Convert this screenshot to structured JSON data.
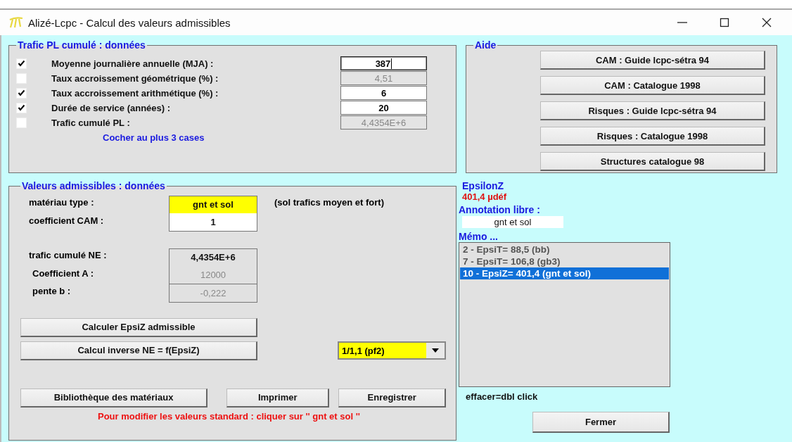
{
  "window": {
    "title": "Alizé-Lcpc - Calcul des valeurs admissibles"
  },
  "trafic": {
    "title": "Trafic PL cumulé : données",
    "rows": [
      {
        "label": "Moyenne journalière annuelle (MJA) :",
        "checked": true,
        "value": "387",
        "focused": true
      },
      {
        "label": "Taux accroissement géométrique (%) :",
        "checked": false,
        "value": "4,51",
        "focused": false
      },
      {
        "label": "Taux accroissement arithmétique (%) :",
        "checked": true,
        "value": "6",
        "focused": false
      },
      {
        "label": "Durée de service  (années) :",
        "checked": true,
        "value": "20",
        "focused": false
      },
      {
        "label": "Trafic cumulé PL :",
        "checked": false,
        "value": "4,4354E+6",
        "focused": false
      }
    ],
    "hint": "Cocher au plus 3 cases"
  },
  "aide": {
    "title": "Aide",
    "buttons": [
      "CAM : Guide lcpc-sétra 94",
      "CAM : Catalogue 1998",
      "Risques : Guide lcpc-sétra 94",
      "Risques : Catalogue 1998",
      "Structures catalogue 98"
    ]
  },
  "valeurs": {
    "title": "Valeurs admissibles : données",
    "materiau": {
      "label": "matériau type :",
      "value": "gnt et sol",
      "note": "(sol trafics moyen et fort)"
    },
    "cam": {
      "label": "coefficient CAM :",
      "value": "1"
    },
    "fields": [
      {
        "label": "trafic cumulé NE :",
        "value": "4,4354E+6",
        "disabled": false
      },
      {
        "label": "Coefficient A :",
        "value": "12000",
        "disabled": true
      },
      {
        "label": "pente b :",
        "value": "-0,222",
        "disabled": true
      }
    ],
    "actions": [
      "Calculer EpsiZ admissible",
      "Calcul inverse NE = f(EpsiZ)"
    ],
    "dropdown": {
      "value": "1/1,1 (pf2)"
    },
    "buttons": [
      "Bibliothèque des matériaux",
      "Imprimer",
      "Enregistrer"
    ],
    "warning": "Pour modifier les valeurs standard : cliquer sur '' gnt et sol ''"
  },
  "result": {
    "title": "EpsilonZ",
    "value": "401,4 µdéf"
  },
  "annotation": {
    "label": "Annotation libre :",
    "value": "gnt et sol"
  },
  "memo": {
    "label": "Mémo ...",
    "items": [
      {
        "text": "2 - EpsiT= 88,5 (bb)",
        "selected": false
      },
      {
        "text": "7 - EpsiT= 106,8 (gb3)",
        "selected": false
      },
      {
        "text": "10 - EpsiZ= 401,4 (gnt et sol)",
        "selected": true
      }
    ],
    "hint": "effacer=dbl click"
  },
  "close_button": "Fermer"
}
